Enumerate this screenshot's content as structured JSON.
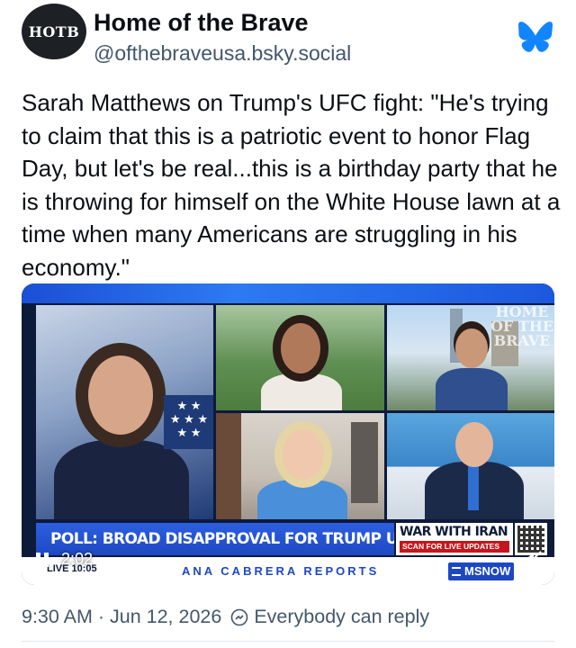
{
  "author": {
    "avatar_text": "HOTB",
    "display_name": "Home of the Brave",
    "handle": "@ofthebraveusa.bsky.social"
  },
  "icons": {
    "service_logo": "butterfly-icon",
    "pause": "pause-icon",
    "mute": "speaker-muted-icon",
    "reply_settings": "reply-settings-icon"
  },
  "post": {
    "text": "Sarah Matthews on Trump's UFC fight: \"He's trying to claim that this is a patriotic event to honor Flag Day, but let's be real...this is a birthday party that he is throwing for himself on the White House lawn at a time when many Americans are struggling in his economy.\""
  },
  "video": {
    "watermark": "HOME OF THE BRAVE",
    "chyron": "POLL: BROAD DISAPPROVAL FOR TRUMP UFC EVENT AT WH",
    "side_headline": "WAR WITH IRAN",
    "side_sub": "SCAN FOR LIVE UPDATES",
    "live_label": "LIVE",
    "broadcast_time": "10:05",
    "show_title": "ANA CABRERA REPORTS",
    "network": "MSNOW",
    "elapsed": "2:02"
  },
  "footer": {
    "timestamp": "9:30 AM · Jun 12, 2026",
    "reply_setting": "Everybody can reply"
  },
  "colors": {
    "bluesky_blue": "#1185fe",
    "text_primary": "#0b0f14",
    "text_secondary": "#42576c",
    "network_blue": "#1e48c2",
    "alert_red": "#c4161c"
  }
}
